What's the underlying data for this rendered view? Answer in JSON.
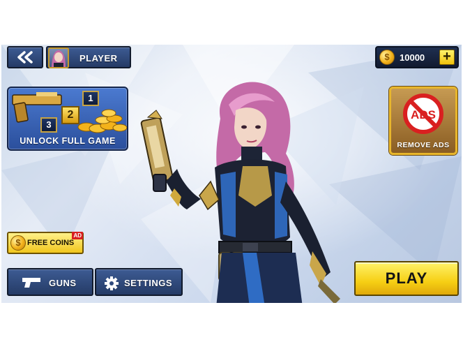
{
  "top_bar": {
    "player_name": "PLAYER",
    "coin_symbol": "$",
    "coin_amount": "10000",
    "add_coins_symbol": "+"
  },
  "promo": {
    "unlock_label": "UNLOCK FULL GAME",
    "badges": [
      "1",
      "2",
      "3"
    ]
  },
  "remove_ads": {
    "icon_text": "ADS",
    "label": "REMOVE ADS"
  },
  "free_coins": {
    "label": "FREE COINS",
    "ad_tag": "AD"
  },
  "bottom_menu": {
    "guns_label": "GUNS",
    "settings_label": "SETTINGS",
    "play_label": "PLAY"
  },
  "colors": {
    "panel_blue": "#2f4a7e",
    "gold_button": "#f6cf14",
    "accent_gold": "#e8b62c"
  }
}
